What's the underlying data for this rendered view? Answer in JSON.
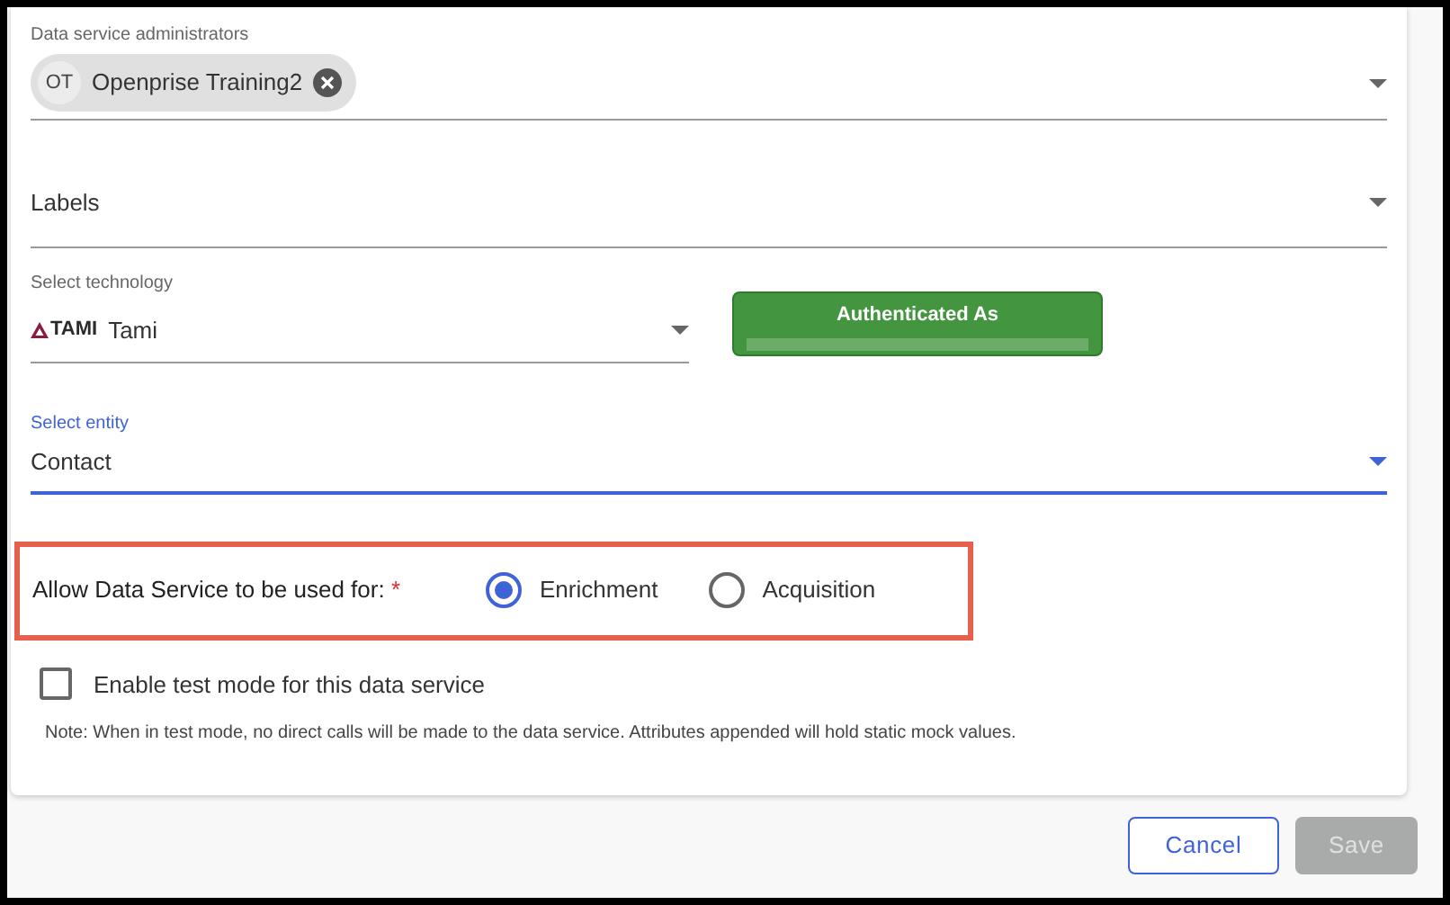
{
  "administrators": {
    "label": "Data service administrators",
    "chips": [
      {
        "initials": "OT",
        "name": "Openprise Training2"
      }
    ]
  },
  "labels": {
    "placeholder": "Labels"
  },
  "technology": {
    "label": "Select technology",
    "logo": "TAMI",
    "value": "Tami"
  },
  "auth": {
    "title": "Authenticated As"
  },
  "entity": {
    "label": "Select entity",
    "value": "Contact",
    "focused": true
  },
  "usage": {
    "label": "Allow Data Service to be used for:",
    "required_mark": "*",
    "options": [
      {
        "label": "Enrichment",
        "selected": true
      },
      {
        "label": "Acquisition",
        "selected": false
      }
    ]
  },
  "test_mode": {
    "label": "Enable test mode for this data service",
    "checked": false,
    "note": "Note: When in test mode, no direct calls will be made to the data service. Attributes appended will hold static mock values."
  },
  "buttons": [
    {
      "label": "Cancel",
      "kind": "outline",
      "disabled": false
    },
    {
      "label": "Save",
      "kind": "filled",
      "disabled": true
    }
  ]
}
